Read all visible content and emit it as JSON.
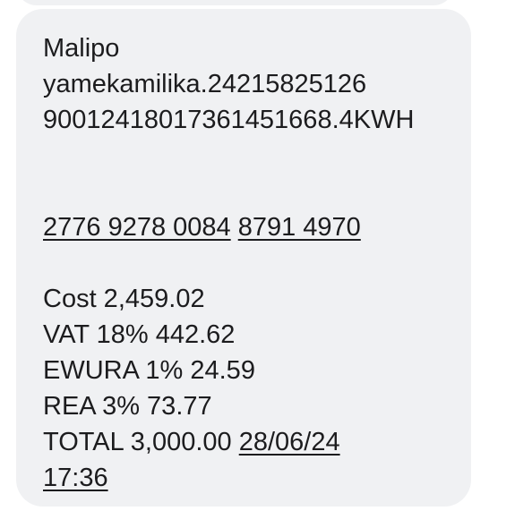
{
  "message": {
    "line1": "Malipo",
    "line2": "yamekamilika.24215825126",
    "line3": "90012418017361451668.4KWH",
    "token_part1": "2776 9278 0084",
    "token_part2": "8791 4970",
    "cost": "Cost 2,459.02",
    "vat": "VAT 18% 442.62",
    "ewura": "EWURA 1% 24.59",
    "rea": "REA 3% 73.77",
    "total_prefix": "TOTAL 3,000.00",
    "date": "28/06/24",
    "time": "17:36"
  }
}
